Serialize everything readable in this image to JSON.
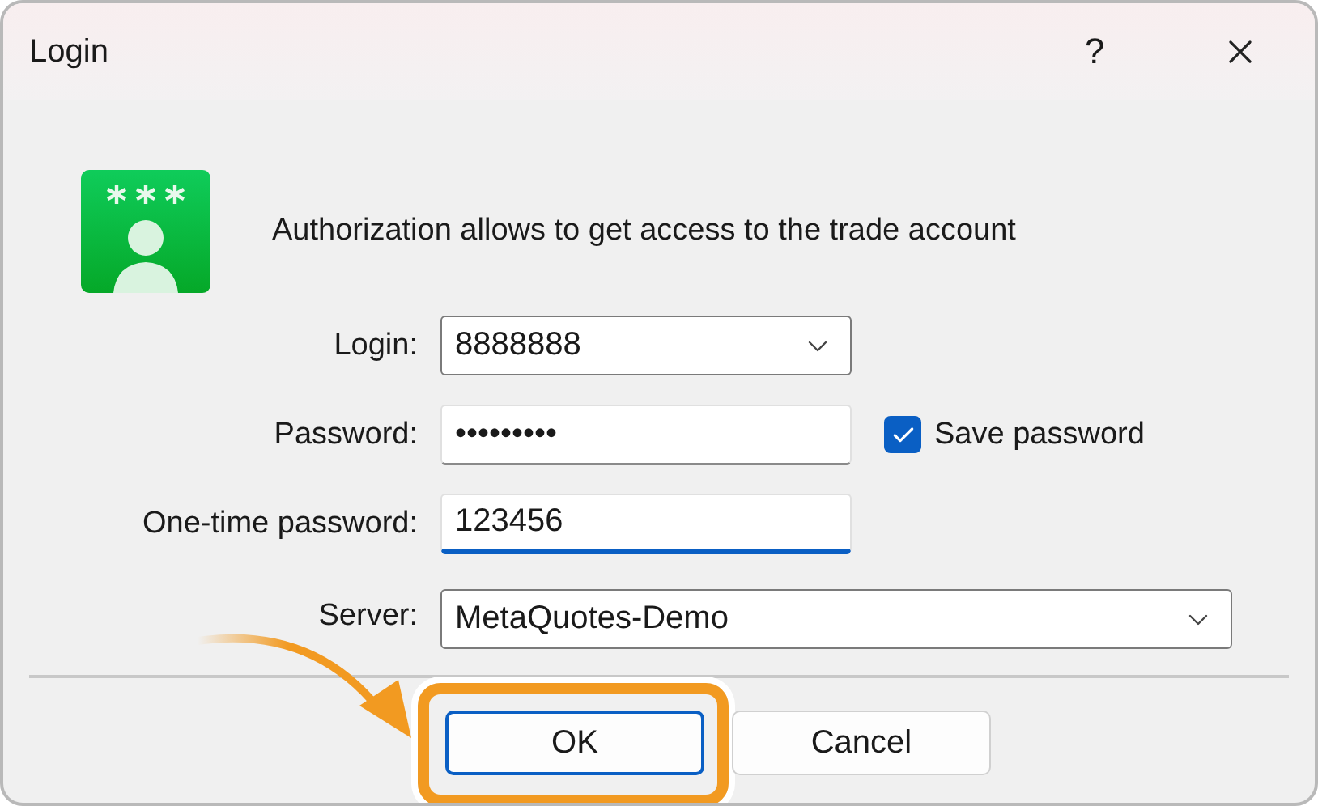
{
  "window": {
    "title": "Login",
    "help_label": "?"
  },
  "message": "Authorization allows to get access to the trade account",
  "fields": [
    {
      "kind": "combo",
      "label": "Login:",
      "value": "8888888",
      "focused": false
    },
    {
      "kind": "password",
      "label": "Password:",
      "value": "•••••••••",
      "focused": false
    },
    {
      "kind": "text",
      "label": "One-time password:",
      "value": "123456",
      "focused": true
    },
    {
      "kind": "combo",
      "label": "Server:",
      "value": "MetaQuotes-Demo",
      "focused": false,
      "wide": true
    }
  ],
  "save_password": {
    "label": "Save password",
    "checked": true
  },
  "buttons": [
    {
      "label": "OK",
      "default": true,
      "highlighted": true
    },
    {
      "label": "Cancel",
      "default": false,
      "highlighted": false
    }
  ]
}
